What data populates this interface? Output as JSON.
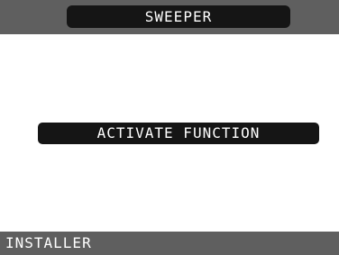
{
  "header": {
    "title": "SWEEPER"
  },
  "main": {
    "action_button_label": "ACTIVATE FUNCTION"
  },
  "footer": {
    "label": "INSTALLER"
  },
  "colors": {
    "header_bar": "#5f5f5f",
    "title_pill": "#151515",
    "content_background": "#ffffff",
    "button_background": "#151515",
    "footer_bar": "#5f5f5f",
    "text_light": "#ffffff"
  }
}
